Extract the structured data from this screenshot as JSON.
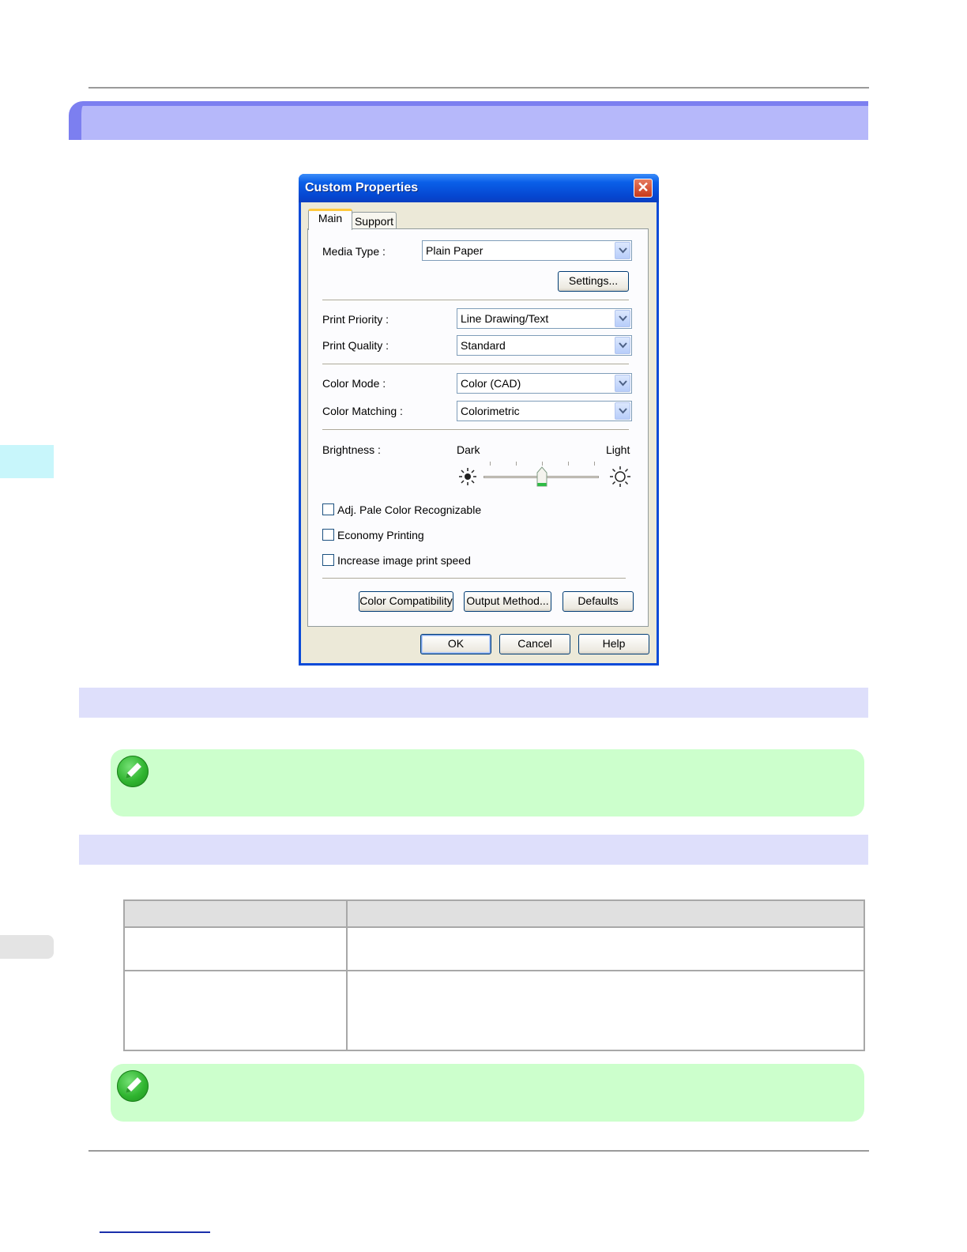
{
  "dialog": {
    "title": "Custom Properties",
    "close_glyph": "✕",
    "tabs": [
      {
        "label": "Main",
        "active": true
      },
      {
        "label": "Support",
        "active": false
      }
    ],
    "media_type": {
      "label": "Media Type :",
      "value": "Plain Paper"
    },
    "settings_button": "Settings...",
    "print_priority": {
      "label": "Print Priority :",
      "value": "Line Drawing/Text"
    },
    "print_quality": {
      "label": "Print Quality :",
      "value": "Standard"
    },
    "color_mode": {
      "label": "Color Mode :",
      "value": "Color (CAD)"
    },
    "color_matching": {
      "label": "Color Matching :",
      "value": "Colorimetric"
    },
    "brightness": {
      "label": "Brightness :",
      "min_label": "Dark",
      "max_label": "Light",
      "level": 0.5
    },
    "checkboxes": [
      {
        "label": "Adj. Pale Color Recognizable",
        "checked": false
      },
      {
        "label": "Economy Printing",
        "checked": false
      },
      {
        "label": "Increase image print speed",
        "checked": false
      }
    ],
    "buttons": {
      "color_compatibility": "Color Compatibility",
      "output_method": "Output Method...",
      "defaults": "Defaults",
      "ok": "OK",
      "cancel": "Cancel",
      "help": "Help"
    }
  },
  "icons": {
    "dark_sun": "sun-dark-icon",
    "light_sun": "sun-light-icon",
    "note": "note-pencil-icon",
    "dropdown": "chevron-down-icon"
  },
  "colors": {
    "title_band": "#b6b8fa",
    "section_band": "#dedffb",
    "note_background": "#ccffcc",
    "dialog_titlebar": "#0a5fe8"
  }
}
